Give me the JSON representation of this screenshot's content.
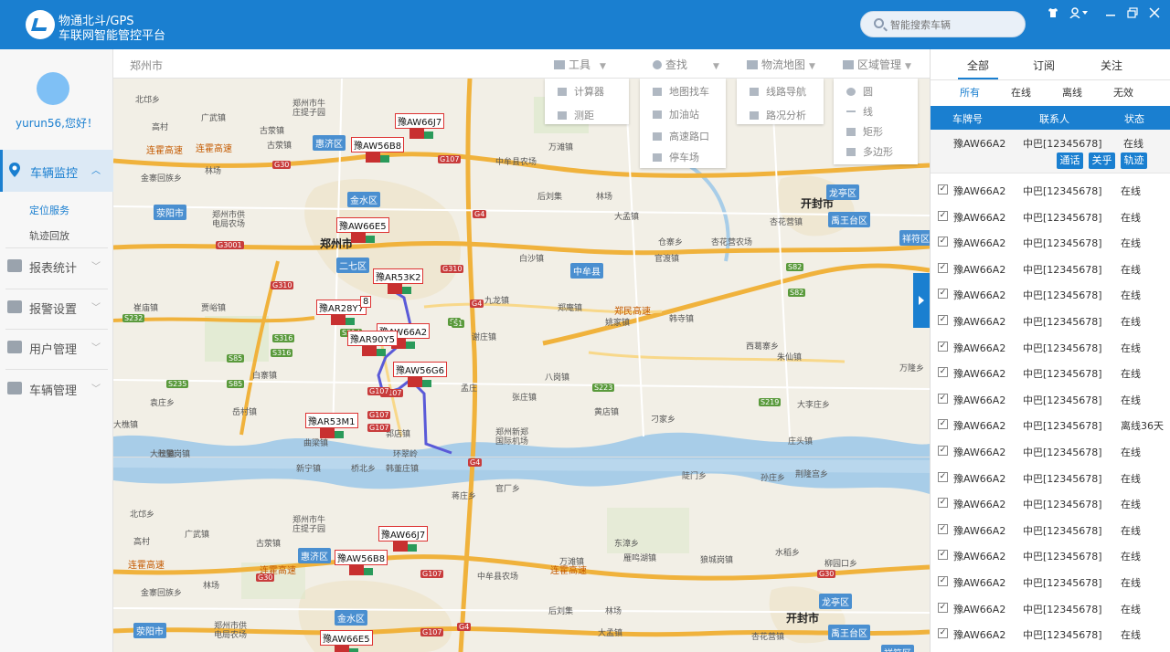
{
  "header": {
    "brand_line1": "物通北斗/GPS",
    "brand_line2": "车联网智能管控平台",
    "search_placeholder": "智能搜索车辆",
    "icons": [
      "shirt-icon",
      "user-icon",
      "minimize-icon",
      "maximize-icon",
      "close-icon"
    ]
  },
  "sidebar": {
    "greeting": "yurun56,您好！",
    "menu": [
      {
        "label": "车辆监控",
        "icon": "location-pin-icon"
      },
      {
        "label": "报表统计",
        "icon": "report-icon"
      },
      {
        "label": "报警设置",
        "icon": "alarm-icon"
      },
      {
        "label": "用户管理",
        "icon": "user-settings-icon"
      },
      {
        "label": "车辆管理",
        "icon": "truck-icon"
      }
    ],
    "submenu": [
      "定位服务",
      "轨迹回放"
    ]
  },
  "toolbar": {
    "city": "郑州市",
    "tools": [
      {
        "label": "工具",
        "icon": "toolbox-icon"
      },
      {
        "label": "查找",
        "icon": "search-icon"
      },
      {
        "label": "物流地图",
        "icon": "map-icon"
      },
      {
        "label": "区域管理",
        "icon": "area-icon"
      }
    ],
    "dropdowns": {
      "tool_items": [
        "计算器",
        "测距"
      ],
      "find_items": [
        "地图找车",
        "加油站",
        "高速路口",
        "停车场"
      ],
      "logistics_items": [
        "线路导航",
        "路况分析"
      ],
      "area_items": [
        "圆",
        "线",
        "矩形",
        "多边形"
      ]
    }
  },
  "map": {
    "labels": [
      {
        "t": "北邙乡"
      },
      {
        "t": "广武镇"
      },
      {
        "t": "郑州市牛"
      },
      {
        "t": "庄提子园"
      },
      {
        "t": "高村"
      },
      {
        "t": "古荥镇"
      },
      {
        "t": "惠济区"
      },
      {
        "t": "古荥镇"
      },
      {
        "t": "连霍高速"
      },
      {
        "t": "连霍高速"
      },
      {
        "t": "金寨回族乡"
      },
      {
        "t": "林场"
      },
      {
        "t": "金水区"
      },
      {
        "t": "荥阳市"
      },
      {
        "t": "郑州市供"
      },
      {
        "t": "电局农场"
      },
      {
        "t": "郑州市"
      },
      {
        "t": "二七区"
      },
      {
        "t": "中牟县农场"
      },
      {
        "t": "万滩镇"
      },
      {
        "t": "后刘集"
      },
      {
        "t": "林场"
      },
      {
        "t": "大孟镇"
      },
      {
        "t": "开封市"
      },
      {
        "t": "龙亭区"
      },
      {
        "t": "禹王台区"
      },
      {
        "t": "杏花营镇"
      },
      {
        "t": "杏花营农场"
      },
      {
        "t": "仓寨乡"
      },
      {
        "t": "官渡镇"
      },
      {
        "t": "中牟县"
      },
      {
        "t": "白沙镇"
      },
      {
        "t": "祥符区"
      },
      {
        "t": "郑民高速"
      },
      {
        "t": "九龙镇"
      },
      {
        "t": "郑庵镇"
      },
      {
        "t": "姚家镇"
      },
      {
        "t": "韩寺镇"
      },
      {
        "t": "西葛寨乡"
      },
      {
        "t": "朱仙镇"
      },
      {
        "t": "万隆乡"
      },
      {
        "t": "崔庙镇"
      },
      {
        "t": "贾峪镇"
      },
      {
        "t": "白寨镇"
      },
      {
        "t": "谢庄镇"
      },
      {
        "t": "八岗镇"
      },
      {
        "t": "张庄镇"
      },
      {
        "t": "黄店镇"
      },
      {
        "t": "刁家乡"
      },
      {
        "t": "大李庄乡"
      },
      {
        "t": "庄头镇"
      },
      {
        "t": "岳村镇"
      },
      {
        "t": "袁庄乡"
      },
      {
        "t": "大樵镇"
      },
      {
        "t": "郭店镇"
      },
      {
        "t": "孟庄"
      },
      {
        "t": "郑州新郑"
      },
      {
        "t": "国际机场"
      },
      {
        "t": "大隗镇"
      },
      {
        "t": "曲梁镇"
      },
      {
        "t": "七里岗镇"
      },
      {
        "t": "环翠岭"
      },
      {
        "t": "新宁镇"
      }
    ],
    "labels2": [
      {
        "t": "桥北乡"
      },
      {
        "t": "韩董庄镇"
      },
      {
        "t": "蒋庄乡"
      },
      {
        "t": "官厂乡"
      },
      {
        "t": "陡门乡"
      },
      {
        "t": "孙庄乡"
      },
      {
        "t": "荆隆宫乡"
      },
      {
        "t": "北邙乡"
      },
      {
        "t": "广武镇"
      },
      {
        "t": "郑州市牛"
      },
      {
        "t": "庄提子园"
      },
      {
        "t": "高村"
      },
      {
        "t": "古荥镇"
      },
      {
        "t": "惠济区"
      },
      {
        "t": "连霍高速"
      },
      {
        "t": "连霍高速"
      },
      {
        "t": "连霍高速"
      },
      {
        "t": "万滩镇"
      },
      {
        "t": "东漳乡"
      },
      {
        "t": "雁鸣湖镇"
      },
      {
        "t": "狼城岗镇"
      },
      {
        "t": "水稻乡"
      },
      {
        "t": "柳园口乡"
      },
      {
        "t": "中牟县农场"
      },
      {
        "t": "金寨回族乡"
      },
      {
        "t": "林场"
      },
      {
        "t": "金水区"
      },
      {
        "t": "荥阳市"
      },
      {
        "t": "郑州市供"
      },
      {
        "t": "电局农场"
      },
      {
        "t": "后刘集"
      },
      {
        "t": "林场"
      },
      {
        "t": "开封市"
      },
      {
        "t": "龙亭区"
      },
      {
        "t": "禹王台区"
      },
      {
        "t": "大孟镇"
      },
      {
        "t": "杏花营镇"
      },
      {
        "t": "祥符区"
      }
    ],
    "vehicles": [
      {
        "plate": "豫AW66J7"
      },
      {
        "plate": "豫AW56B8"
      },
      {
        "plate": "豫AW66E5"
      },
      {
        "plate": "豫AR53K2"
      },
      {
        "plate": "豫AR28Y7"
      },
      {
        "plate": "豫AW66A2"
      },
      {
        "plate": "豫AR90Y5"
      },
      {
        "plate": "豫AW56G6"
      },
      {
        "plate": "豫AR53M1"
      }
    ],
    "vehicles2": [
      {
        "plate": "豫AW66J7"
      },
      {
        "plate": "豫AW56B8"
      },
      {
        "plate": "豫AW66E5"
      }
    ],
    "roads": [
      {
        "t": "G30"
      },
      {
        "t": "G107"
      },
      {
        "t": "G4"
      },
      {
        "t": "G3001"
      },
      {
        "t": "G310"
      },
      {
        "t": "S82"
      },
      {
        "t": "S1"
      },
      {
        "t": "S85"
      },
      {
        "t": "S316"
      },
      {
        "t": "S223"
      },
      {
        "t": "S219"
      },
      {
        "t": "S232"
      },
      {
        "t": "S314"
      },
      {
        "t": "G107"
      },
      {
        "t": "G4"
      },
      {
        "t": "G310"
      },
      {
        "t": "S82"
      },
      {
        "t": "S316"
      },
      {
        "t": "G107"
      },
      {
        "t": "G107"
      },
      {
        "t": "S235"
      },
      {
        "t": "S85"
      },
      {
        "t": "G4"
      },
      {
        "t": "G107"
      },
      {
        "t": "S1"
      }
    ],
    "roads2": [
      {
        "t": "G30"
      },
      {
        "t": "G107"
      },
      {
        "t": "G4"
      },
      {
        "t": "G30"
      },
      {
        "t": "G107"
      }
    ],
    "overlap_label": "8"
  },
  "right_panel": {
    "tabs": [
      "全部",
      "订阅",
      "关注"
    ],
    "filters": [
      "所有",
      "在线",
      "离线",
      "无效"
    ],
    "columns": [
      "车牌号",
      "联系人",
      "状态"
    ],
    "selected": {
      "plate": "豫AW66A2",
      "contact": "中巴[12345678]",
      "status": "在线",
      "actions": [
        "通话",
        "关乎",
        "轨迹"
      ]
    },
    "rows": [
      {
        "plate": "豫AW66A2",
        "contact": "中巴[12345678]",
        "status": "在线"
      },
      {
        "plate": "豫AW66A2",
        "contact": "中巴[12345678]",
        "status": "在线"
      },
      {
        "plate": "豫AW66A2",
        "contact": "中巴[12345678]",
        "status": "在线"
      },
      {
        "plate": "豫AW66A2",
        "contact": "中巴[12345678]",
        "status": "在线"
      },
      {
        "plate": "豫AW66A2",
        "contact": "中巴[12345678]",
        "status": "在线"
      },
      {
        "plate": "豫AW66A2",
        "contact": "中巴[12345678]",
        "status": "在线"
      },
      {
        "plate": "豫AW66A2",
        "contact": "中巴[12345678]",
        "status": "在线"
      },
      {
        "plate": "豫AW66A2",
        "contact": "中巴[12345678]",
        "status": "在线"
      },
      {
        "plate": "豫AW66A2",
        "contact": "中巴[12345678]",
        "status": "在线"
      },
      {
        "plate": "豫AW66A2",
        "contact": "中巴[12345678]",
        "status": "离线36天"
      },
      {
        "plate": "豫AW66A2",
        "contact": "中巴[12345678]",
        "status": "在线"
      },
      {
        "plate": "豫AW66A2",
        "contact": "中巴[12345678]",
        "status": "在线"
      },
      {
        "plate": "豫AW66A2",
        "contact": "中巴[12345678]",
        "status": "在线"
      },
      {
        "plate": "豫AW66A2",
        "contact": "中巴[12345678]",
        "status": "在线"
      },
      {
        "plate": "豫AW66A2",
        "contact": "中巴[12345678]",
        "status": "在线"
      },
      {
        "plate": "豫AW66A2",
        "contact": "中巴[12345678]",
        "status": "在线"
      },
      {
        "plate": "豫AW66A2",
        "contact": "中巴[12345678]",
        "status": "在线"
      },
      {
        "plate": "豫AW66A2",
        "contact": "中巴[12345678]",
        "status": "在线"
      }
    ],
    "checkbox_mark": "✓"
  },
  "colors": {
    "primary": "#1a7fd0",
    "highway": "#f0b23c",
    "route": "#5a5ad8",
    "water": "#a8cde8"
  }
}
